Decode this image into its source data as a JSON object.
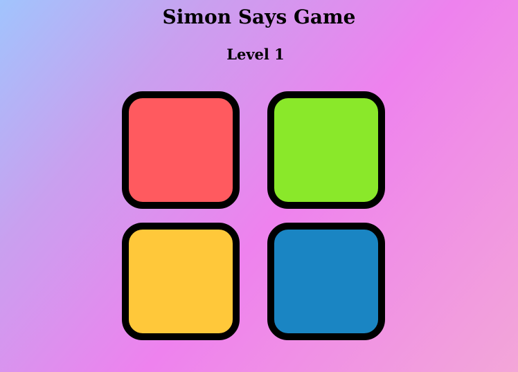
{
  "header": {
    "title": "Simon Says Game",
    "level_text": "Level 1"
  },
  "buttons": [
    {
      "id": "red",
      "color": "#ff5a5f"
    },
    {
      "id": "green",
      "color": "#8ae82a"
    },
    {
      "id": "yellow",
      "color": "#ffc83a"
    },
    {
      "id": "blue",
      "color": "#1a85c3"
    }
  ],
  "colors": {
    "border": "#000000",
    "text": "#000000"
  }
}
